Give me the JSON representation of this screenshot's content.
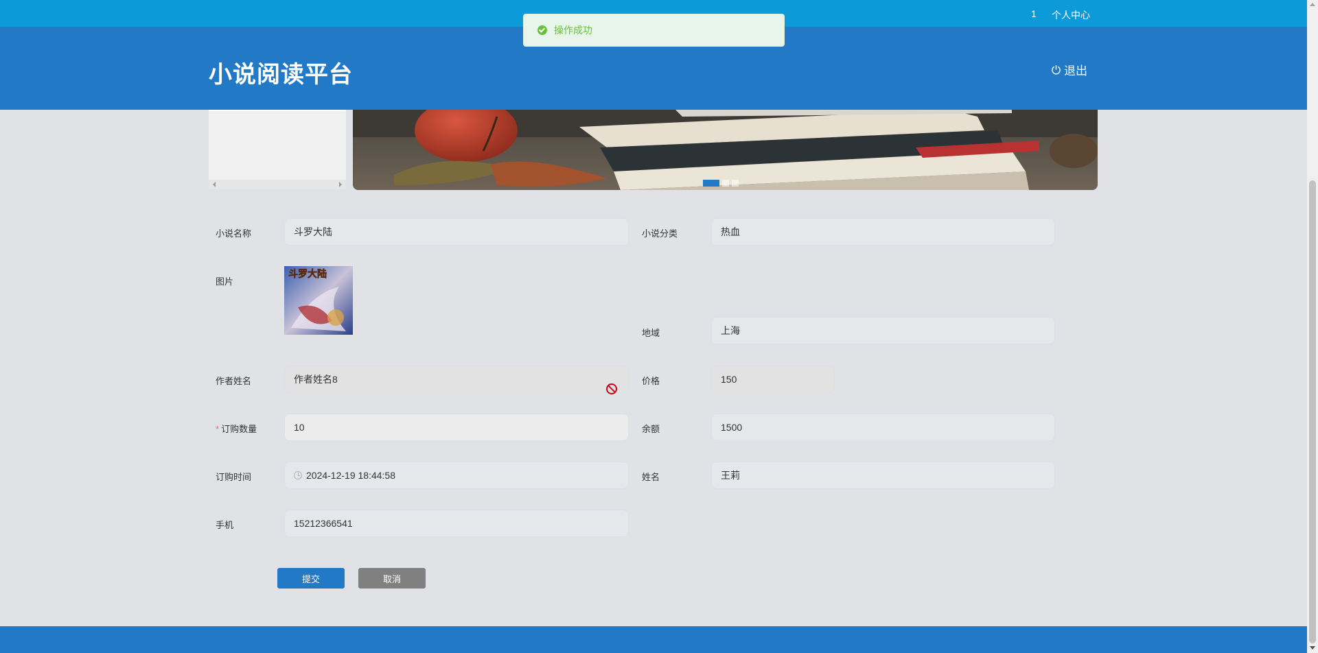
{
  "topbar": {
    "user_id": "1",
    "personal_center": "个人中心"
  },
  "header": {
    "site_title": "小说阅读平台",
    "logout_label": "退出"
  },
  "toast": {
    "message": "操作成功"
  },
  "banner": {
    "slide_count": 3,
    "active_slide": 1
  },
  "form": {
    "novel_name": {
      "label": "小说名称",
      "value": "斗罗大陆"
    },
    "novel_category": {
      "label": "小说分类",
      "value": "热血"
    },
    "image": {
      "label": "图片",
      "caption": "斗罗大陆"
    },
    "region": {
      "label": "地域",
      "value": "上海"
    },
    "author_name": {
      "label": "作者姓名",
      "value": "作者姓名8"
    },
    "price": {
      "label": "价格",
      "value": "150"
    },
    "order_quantity": {
      "label": "订购数量",
      "required_mark": "*",
      "value": "10"
    },
    "balance": {
      "label": "余额",
      "value": "1500"
    },
    "order_time": {
      "label": "订购时间",
      "value": "2024-12-19 18:44:58"
    },
    "name": {
      "label": "姓名",
      "value": "王莉"
    },
    "phone": {
      "label": "手机",
      "value": "15212366541"
    }
  },
  "buttons": {
    "submit": "提交",
    "cancel": "取消"
  },
  "colors": {
    "topbar": "#0c9ad8",
    "header": "#2279c6",
    "success": "#67c23a",
    "cancel": "#808080"
  }
}
